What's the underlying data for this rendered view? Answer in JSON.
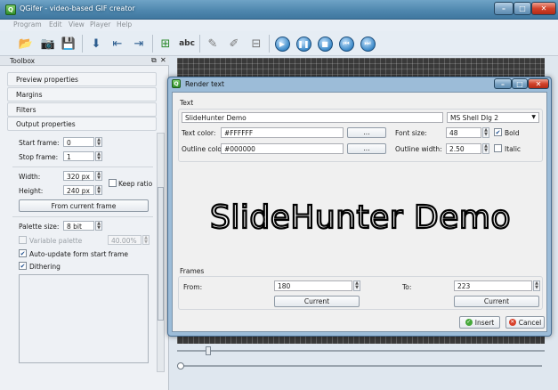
{
  "window": {
    "title": "QGifer - video-based GIF creator"
  },
  "menu": [
    "Program",
    "Edit",
    "View",
    "Player",
    "Help"
  ],
  "toolbox": {
    "title": "Toolbox",
    "sections": [
      "Preview properties",
      "Margins",
      "Filters",
      "Output properties"
    ],
    "start_frame": {
      "label": "Start frame:",
      "value": "0"
    },
    "stop_frame": {
      "label": "Stop frame:",
      "value": "1"
    },
    "width": {
      "label": "Width:",
      "value": "320 px"
    },
    "height": {
      "label": "Height:",
      "value": "240 px"
    },
    "keep_ratio": "Keep ratio",
    "from_current_frame": "From current frame",
    "palette_size": {
      "label": "Palette size:",
      "value": "8 bit"
    },
    "variable_palette": {
      "label": "Variable palette",
      "value": "40.00%"
    },
    "auto_update": "Auto-update form start frame",
    "dithering": "Dithering"
  },
  "dialog": {
    "title": "Render text",
    "text_group": "Text",
    "text_value": "SlideHunter Demo",
    "font": "MS Shell Dlg 2",
    "text_color_label": "Text color:",
    "text_color_value": "#FFFFFF",
    "outline_color_label": "Outline color:",
    "outline_color_value": "#000000",
    "ellipsis": "...",
    "font_size_label": "Font size:",
    "font_size_value": "48",
    "outline_width_label": "Outline width:",
    "outline_width_value": "2.50",
    "bold": "Bold",
    "italic": "Italic",
    "preview_text": "SlideHunter Demo",
    "frames_group": "Frames",
    "from_label": "From:",
    "from_value": "180",
    "to_label": "To:",
    "to_value": "223",
    "current": "Current",
    "insert": "Insert",
    "cancel": "Cancel"
  },
  "colors": {
    "accent": "#3f779f",
    "text_fill": "#FFFFFF",
    "outline": "#000000"
  }
}
